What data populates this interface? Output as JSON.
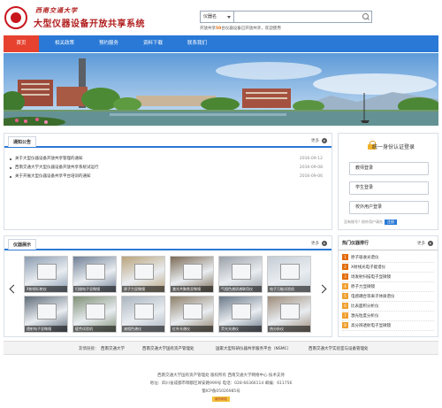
{
  "header": {
    "university_name": "西南交通大学",
    "system_title": "大型仪器设备开放共享系统",
    "search": {
      "select_value": "仪器名",
      "placeholder": "",
      "hot_prefix": "开放共享",
      "hot_count": "50",
      "hot_suffix": "台仪器设备已开放共享，欢迎使用"
    }
  },
  "nav": {
    "items": [
      {
        "label": "首页"
      },
      {
        "label": "相关政策"
      },
      {
        "label": "预约服务"
      },
      {
        "label": "资料下载"
      },
      {
        "label": "联系我们"
      }
    ]
  },
  "notices": {
    "tab_label": "通知公告",
    "more_label": "更多",
    "items": [
      {
        "title": "关于大型仪器设备开放共享管理的通知",
        "date": "2016-09-12"
      },
      {
        "title": "西南交通大学大型仪器设备开放共享系统试运行",
        "date": "2016-09-08"
      },
      {
        "title": "关于开展大型仪器设备共享平台培训的通知",
        "date": "2016-09-06"
      }
    ]
  },
  "login": {
    "title": "统一身份认证登录",
    "buttons": [
      {
        "label": "教师登录"
      },
      {
        "label": "学生登录"
      },
      {
        "label": "校外用户登录"
      }
    ],
    "note": "没有账号？校外用户请先",
    "register_label": "注册"
  },
  "instruments": {
    "tab_label": "仪器展示",
    "more_label": "更多",
    "items": [
      {
        "label": "X射线衍射仪",
        "color": "#8a9bb0"
      },
      {
        "label": "扫描电子显微镜",
        "color": "#6f7f95"
      },
      {
        "label": "原子力显微镜",
        "color": "#b9a37a"
      },
      {
        "label": "激光共聚焦显微镜",
        "color": "#7c6a55"
      },
      {
        "label": "气相色谱质谱联用仪",
        "color": "#9aa0a8"
      },
      {
        "label": "电子万能试验机",
        "color": "#c4ccd4"
      },
      {
        "label": "透射电子显微镜",
        "color": "#5f6b78"
      },
      {
        "label": "疲劳试验机",
        "color": "#7e8f74"
      },
      {
        "label": "液相色谱仪",
        "color": "#a9b3bd"
      },
      {
        "label": "红外光谱仪",
        "color": "#8e7f6a"
      },
      {
        "label": "荧光光谱仪",
        "color": "#6a7888"
      },
      {
        "label": "热分析仪",
        "color": "#9d8c7a"
      }
    ]
  },
  "ranking": {
    "title": "热门仪器排行",
    "more_label": "更多",
    "items": [
      {
        "label": "原子吸收光谱仪",
        "color": "#e26b0a"
      },
      {
        "label": "X射线光电子能谱仪",
        "color": "#e26b0a"
      },
      {
        "label": "场发射扫描电子显微镜",
        "color": "#e26b0a"
      },
      {
        "label": "原子力显微镜",
        "color": "#f0a030"
      },
      {
        "label": "电感耦合等离子体质谱仪",
        "color": "#f0a030"
      },
      {
        "label": "比表面积分析仪",
        "color": "#f0a030"
      },
      {
        "label": "激光粒度分析仪",
        "color": "#f0a030"
      },
      {
        "label": "高分辨透射电子显微镜",
        "color": "#f0a030"
      }
    ]
  },
  "links": {
    "label": "友情链接：",
    "items": [
      {
        "label": "西南交通大学"
      },
      {
        "label": "西南交通大学国有资产管理处"
      },
      {
        "label": "国家大型科研仪器共享服务平台（NSMC）"
      },
      {
        "label": "西南交通大学实验室与设备管理处"
      }
    ]
  },
  "footer": {
    "line1": "西南交通大学国有资产管理处 版权所有   西南交通大学网络中心 技术支持",
    "line2": "地址：四川省成都市郫都区犀安路999号   电话：028-66366114   邮编：611756",
    "line3": "蜀ICP备05026985号",
    "badge": "政府网站"
  },
  "colors": {
    "brand_red": "#b01c1c",
    "nav_blue": "#2a79d6",
    "nav_active": "#e6422f"
  }
}
